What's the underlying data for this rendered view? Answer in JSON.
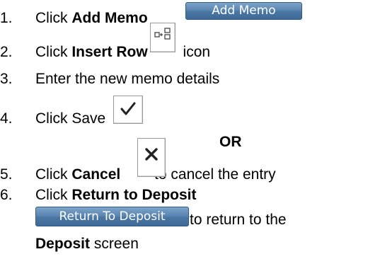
{
  "steps": [
    {
      "number": "1.",
      "parts": [
        "Click ",
        "Add Memo"
      ]
    },
    {
      "number": "2.",
      "parts": [
        "Click ",
        "Insert Row",
        " icon"
      ]
    },
    {
      "number": "3.",
      "parts": [
        "Enter the new memo details"
      ]
    },
    {
      "number": "4.",
      "parts": [
        "Click Save "
      ]
    },
    {
      "number": "5.",
      "parts": [
        "Click ",
        "Cancel",
        " to cancel the entry"
      ]
    },
    {
      "number": "6.",
      "parts": [
        "Click ",
        "Return to Deposit"
      ]
    }
  ],
  "step6_cont": {
    "before": " to return to the",
    "bold": "Deposit",
    "after": " screen"
  },
  "or_label": "OR",
  "buttons": {
    "add_memo": "Add Memo",
    "return_to_deposit": "Return To Deposit"
  },
  "icons": {
    "insert_row": "insert-row-icon",
    "save": "checkmark-icon",
    "cancel": "close-x-icon"
  }
}
